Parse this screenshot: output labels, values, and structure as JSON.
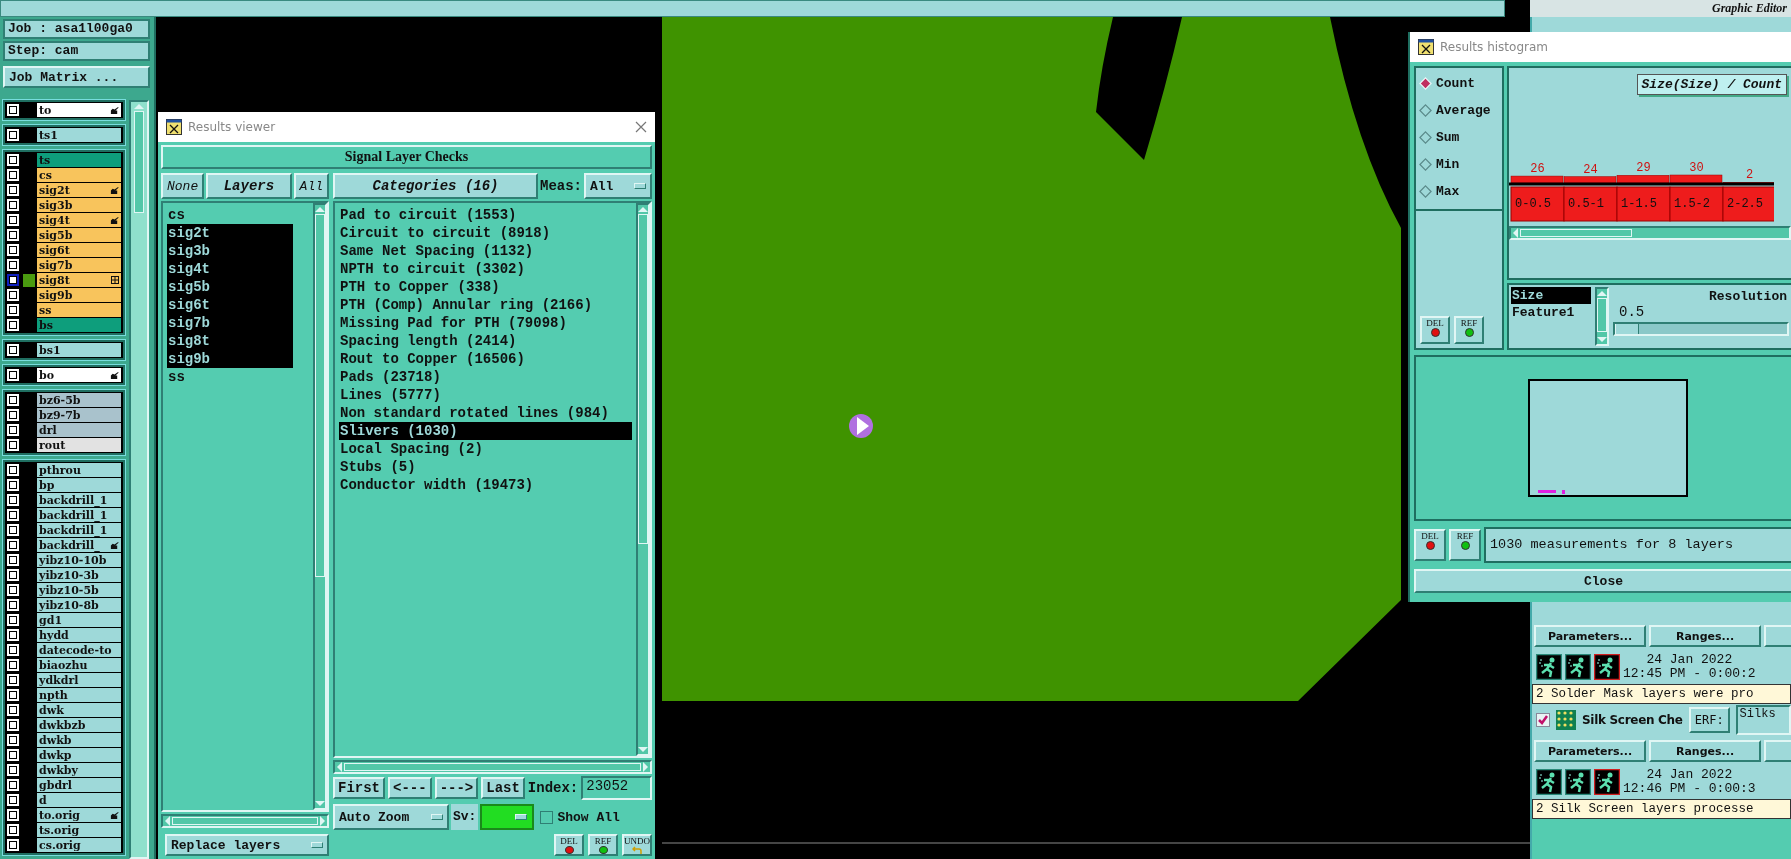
{
  "top_bar": {
    "app_subtitle": "Graphic Editor"
  },
  "job_panel": {
    "job": "Job : asa1l00ga0",
    "step": "Step: cam",
    "matrix_button": "Job Matrix ..."
  },
  "layer_groups": [
    {
      "layers": [
        {
          "name": "to",
          "color": "#ffffff",
          "checked": false,
          "displayed": false,
          "kind": "hand"
        }
      ]
    },
    {
      "layers": [
        {
          "name": "ts1",
          "color": "#9ed9d9",
          "checked": false,
          "displayed": false,
          "kind": "plain"
        }
      ]
    },
    {
      "layers": [
        {
          "name": "ts",
          "color": "#0e9e7c",
          "checked": false,
          "displayed": false,
          "kind": "plain"
        },
        {
          "name": "cs",
          "color": "#f8c45c",
          "checked": false,
          "displayed": false,
          "kind": "plain"
        },
        {
          "name": "sig2t",
          "color": "#f8c45c",
          "checked": false,
          "displayed": false,
          "kind": "hand"
        },
        {
          "name": "sig3b",
          "color": "#f8c45c",
          "checked": false,
          "displayed": false,
          "kind": "plain"
        },
        {
          "name": "sig4t",
          "color": "#f8c45c",
          "checked": false,
          "displayed": false,
          "kind": "hand"
        },
        {
          "name": "sig5b",
          "color": "#f8c45c",
          "checked": false,
          "displayed": false,
          "kind": "plain"
        },
        {
          "name": "sig6t",
          "color": "#f8c45c",
          "checked": false,
          "displayed": false,
          "kind": "plain"
        },
        {
          "name": "sig7b",
          "color": "#f8c45c",
          "checked": false,
          "displayed": false,
          "kind": "plain"
        },
        {
          "name": "sig8t",
          "color": "#f8c45c",
          "checked": false,
          "displayed": true,
          "kind": "work"
        },
        {
          "name": "sig9b",
          "color": "#f8c45c",
          "checked": false,
          "displayed": false,
          "kind": "plain"
        },
        {
          "name": "ss",
          "color": "#f8c45c",
          "checked": false,
          "displayed": false,
          "kind": "plain"
        },
        {
          "name": "bs",
          "color": "#0e9e7c",
          "checked": false,
          "displayed": false,
          "kind": "plain"
        }
      ]
    },
    {
      "layers": [
        {
          "name": "bs1",
          "color": "#9ed9d9",
          "checked": false,
          "displayed": false,
          "kind": "plain"
        }
      ]
    },
    {
      "layers": [
        {
          "name": "bo",
          "color": "#ffffff",
          "checked": false,
          "displayed": false,
          "kind": "hand"
        }
      ]
    },
    {
      "layers": [
        {
          "name": "bz6-5b",
          "color": "#a9c2cc",
          "checked": false,
          "displayed": false,
          "kind": "plain"
        },
        {
          "name": "bz9-7b",
          "color": "#a9c2cc",
          "checked": false,
          "displayed": false,
          "kind": "plain"
        },
        {
          "name": "drl",
          "color": "#a9c2cc",
          "checked": false,
          "displayed": false,
          "kind": "plain"
        },
        {
          "name": "rout",
          "color": "#e2e2e2",
          "checked": false,
          "displayed": false,
          "kind": "plain"
        }
      ]
    },
    {
      "layers": [
        {
          "name": "pthrou",
          "color": "#9ed9d9",
          "checked": false,
          "displayed": false,
          "kind": "plain"
        },
        {
          "name": "bp",
          "color": "#9ed9d9",
          "checked": false,
          "displayed": false,
          "kind": "plain"
        },
        {
          "name": "backdrill_1",
          "color": "#9ed9d9",
          "checked": false,
          "displayed": false,
          "kind": "plain"
        },
        {
          "name": "backdrill_1",
          "color": "#9ed9d9",
          "checked": false,
          "displayed": false,
          "kind": "plain"
        },
        {
          "name": "backdrill_1",
          "color": "#9ed9d9",
          "checked": false,
          "displayed": false,
          "kind": "plain"
        },
        {
          "name": "backdrill_",
          "color": "#9ed9d9",
          "checked": false,
          "displayed": false,
          "kind": "hand"
        },
        {
          "name": "yibz10-10b",
          "color": "#9ed9d9",
          "checked": false,
          "displayed": false,
          "kind": "plain"
        },
        {
          "name": "yibz10-3b",
          "color": "#9ed9d9",
          "checked": false,
          "displayed": false,
          "kind": "plain"
        },
        {
          "name": "yibz10-5b",
          "color": "#9ed9d9",
          "checked": false,
          "displayed": false,
          "kind": "plain"
        },
        {
          "name": "yibz10-8b",
          "color": "#9ed9d9",
          "checked": false,
          "displayed": false,
          "kind": "plain"
        },
        {
          "name": "gd1",
          "color": "#9ed9d9",
          "checked": false,
          "displayed": false,
          "kind": "plain"
        },
        {
          "name": "hydd",
          "color": "#9ed9d9",
          "checked": false,
          "displayed": false,
          "kind": "plain"
        },
        {
          "name": "datecode-to",
          "color": "#9ed9d9",
          "checked": false,
          "displayed": false,
          "kind": "plain"
        },
        {
          "name": "biaozhu",
          "color": "#9ed9d9",
          "checked": false,
          "displayed": false,
          "kind": "plain"
        },
        {
          "name": "ydkdrl",
          "color": "#9ed9d9",
          "checked": false,
          "displayed": false,
          "kind": "plain"
        },
        {
          "name": "npth",
          "color": "#9ed9d9",
          "checked": false,
          "displayed": false,
          "kind": "plain"
        },
        {
          "name": "dwk",
          "color": "#9ed9d9",
          "checked": false,
          "displayed": false,
          "kind": "plain"
        },
        {
          "name": "dwkbzb",
          "color": "#9ed9d9",
          "checked": false,
          "displayed": false,
          "kind": "plain"
        },
        {
          "name": "dwkb",
          "color": "#9ed9d9",
          "checked": false,
          "displayed": false,
          "kind": "plain"
        },
        {
          "name": "dwkp",
          "color": "#9ed9d9",
          "checked": false,
          "displayed": false,
          "kind": "plain"
        },
        {
          "name": "dwkby",
          "color": "#9ed9d9",
          "checked": false,
          "displayed": false,
          "kind": "plain"
        },
        {
          "name": "gbdrl",
          "color": "#9ed9d9",
          "checked": false,
          "displayed": false,
          "kind": "plain"
        },
        {
          "name": "d",
          "color": "#9ed9d9",
          "checked": false,
          "displayed": false,
          "kind": "plain"
        },
        {
          "name": "to.orig",
          "color": "#9ed9d9",
          "checked": false,
          "displayed": false,
          "kind": "hand"
        },
        {
          "name": "ts.orig",
          "color": "#9ed9d9",
          "checked": false,
          "displayed": false,
          "kind": "plain"
        },
        {
          "name": "cs.orig",
          "color": "#9ed9d9",
          "checked": false,
          "displayed": false,
          "kind": "plain"
        }
      ]
    }
  ],
  "results_viewer": {
    "title": "Results viewer",
    "check_name": "Signal Layer Checks",
    "none_button": "None",
    "layers_button": "Layers",
    "all_button": "All",
    "categories_button": "Categories (16)",
    "meas_label": "Meas:",
    "meas_value": "All",
    "layers": [
      {
        "name": "cs",
        "selected": false
      },
      {
        "name": "sig2t",
        "selected": true
      },
      {
        "name": "sig3b",
        "selected": true
      },
      {
        "name": "sig4t",
        "selected": true
      },
      {
        "name": "sig5b",
        "selected": true
      },
      {
        "name": "sig6t",
        "selected": true
      },
      {
        "name": "sig7b",
        "selected": true
      },
      {
        "name": "sig8t",
        "selected": true
      },
      {
        "name": "sig9b",
        "selected": true
      },
      {
        "name": "ss",
        "selected": false
      }
    ],
    "categories": [
      {
        "label": "Pad to circuit (1553)",
        "selected": false
      },
      {
        "label": "Circuit to circuit (8918)",
        "selected": false
      },
      {
        "label": "Same Net Spacing (1132)",
        "selected": false
      },
      {
        "label": "NPTH to circuit (3302)",
        "selected": false
      },
      {
        "label": "PTH to Copper (338)",
        "selected": false
      },
      {
        "label": "PTH (Comp) Annular ring (2166)",
        "selected": false
      },
      {
        "label": "Missing Pad for PTH (79098)",
        "selected": false
      },
      {
        "label": "Spacing length (2414)",
        "selected": false
      },
      {
        "label": "Rout to Copper (16506)",
        "selected": false
      },
      {
        "label": "Pads (23718)",
        "selected": false
      },
      {
        "label": "Lines (5777)",
        "selected": false
      },
      {
        "label": "Non standard rotated lines (984)",
        "selected": false
      },
      {
        "label": "Slivers (1030)",
        "selected": true
      },
      {
        "label": "Local Spacing (2)",
        "selected": false
      },
      {
        "label": "Stubs (5)",
        "selected": false
      },
      {
        "label": "Conductor width (19473)",
        "selected": false
      }
    ],
    "first_button": "First",
    "prev_button": "<---",
    "next_button": "--->",
    "last_button": "Last",
    "index_label": "Index:",
    "index_value": "23052",
    "zoom_mode": "Auto Zoom",
    "sv_label": "Sv:",
    "show_all": {
      "label": "Show All",
      "checked": false
    },
    "replace_mode": "Replace layers",
    "tool_buttons": [
      {
        "kind": "delete",
        "label": "DEL"
      },
      {
        "kind": "refresh",
        "label": "REF"
      },
      {
        "kind": "undo",
        "label": "UNDO"
      }
    ]
  },
  "histogram": {
    "title": "Results histogram",
    "modes": [
      {
        "label": "Count",
        "selected": true
      },
      {
        "label": "Average",
        "selected": false
      },
      {
        "label": "Sum",
        "selected": false
      },
      {
        "label": "Min",
        "selected": false
      },
      {
        "label": "Max",
        "selected": false
      }
    ],
    "panel_buttons": [
      {
        "kind": "delete",
        "label": "DEL"
      },
      {
        "kind": "refresh",
        "label": "REF"
      }
    ],
    "chart_data": {
      "type": "bar",
      "title": "Size(Size) / Count",
      "categories": [
        "0-0.5",
        "0.5-1",
        "1-1.5",
        "1.5-2",
        "2-2.5"
      ],
      "values": [
        26,
        24,
        29,
        30,
        2
      ],
      "data_labels": true
    },
    "fields": [
      {
        "label": "Size",
        "selected": true
      },
      {
        "label": "Feature1",
        "selected": false
      }
    ],
    "resolution_label": "Resolution",
    "resolution_value": "0.5",
    "resolution_slider": {
      "level": 0
    },
    "summary_buttons": [
      {
        "kind": "delete",
        "label": "DEL"
      },
      {
        "kind": "refresh",
        "label": "REF"
      }
    ],
    "summary": "1030 measurements for 8 layers",
    "close_button": "Close"
  },
  "checklist": {
    "actions": [
      {
        "parameters_button": "Parameters...",
        "ranges_button": "Ranges...",
        "date": "24 Jan 2022",
        "time": "12:45 PM - 0:00:2",
        "message": "2 Solder Mask layers were pro"
      },
      {
        "name": "Silk Screen Che",
        "checked": true,
        "erf_button": "ERF:",
        "erf_value": "Silks",
        "parameters_button": "Parameters...",
        "ranges_button": "Ranges...",
        "date": "24 Jan 2022",
        "time": "12:46 PM - 0:00:3",
        "message": "2 Silk Screen layers processe"
      }
    ]
  }
}
